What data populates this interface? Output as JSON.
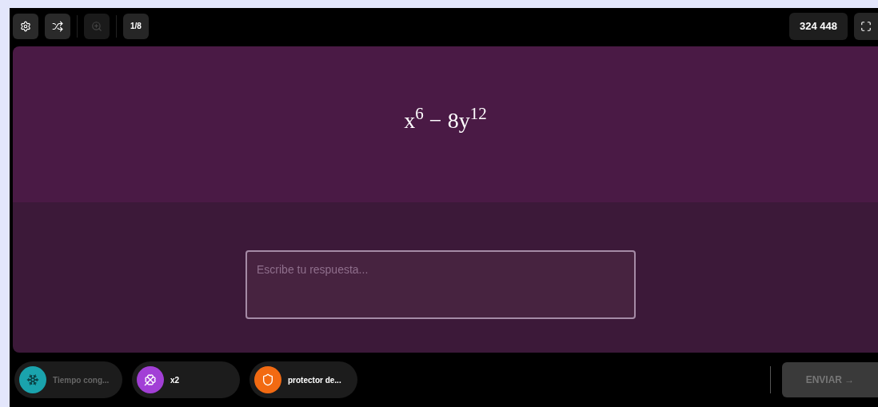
{
  "toolbar": {
    "buttons": [
      {
        "kind": "settings",
        "disabled": false
      },
      {
        "kind": "shuffle",
        "disabled": false
      },
      {
        "kind": "zoom",
        "disabled": true
      }
    ],
    "counter": "1/8",
    "score": "324 448"
  },
  "question": {
    "expression": "x$^{6}$ − 8y$^{12}$"
  },
  "answer": {
    "placeholder": "Escribe tu respuesta..."
  },
  "powerups": [
    {
      "label": "Tiempo cong...",
      "color": "#1aa3ad",
      "disabled": true
    },
    {
      "label": "x2",
      "color": "#a23fd6",
      "disabled": false
    },
    {
      "label": "protector de...",
      "color": "#f26a12",
      "disabled": false
    }
  ],
  "submit": {
    "label": "ENVIAR →",
    "disabled": true
  }
}
